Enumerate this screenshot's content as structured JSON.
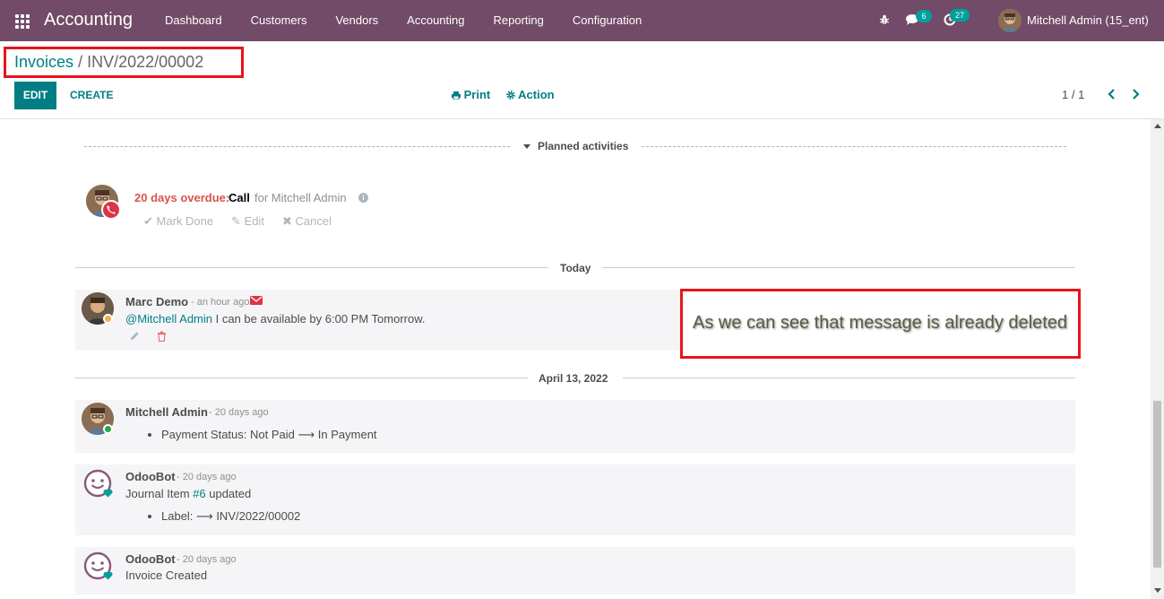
{
  "navbar": {
    "app_name": "Accounting",
    "menu": [
      "Dashboard",
      "Customers",
      "Vendors",
      "Accounting",
      "Reporting",
      "Configuration"
    ],
    "messages_count": "6",
    "activities_count": "27",
    "user": "Mitchell Admin (15_ent)",
    "bg_color": "#714b67"
  },
  "breadcrumb": {
    "parent": "Invoices",
    "separator": "/",
    "current": "INV/2022/00002"
  },
  "buttons": {
    "edit": "EDIT",
    "create": "CREATE",
    "print": "Print",
    "action": "Action"
  },
  "pager": {
    "value": "1 / 1"
  },
  "planned": {
    "title": "Planned activities",
    "activity": {
      "overdue": "20 days overdue:",
      "type": "Call",
      "assignee": "for Mitchell Admin",
      "mark_done": "Mark Done",
      "edit": "Edit",
      "cancel": "Cancel"
    }
  },
  "separators": {
    "today": "Today",
    "older": "April 13, 2022"
  },
  "messages": [
    {
      "author": "Marc Demo",
      "date": "- an hour ago",
      "mention": "@Mitchell Admin",
      "body": " I can be available by 6:00 PM Tomorrow."
    },
    {
      "author": "Mitchell Admin",
      "date": "- 20 days ago",
      "tracking_field": "Payment Status:",
      "old_value": "Not Paid",
      "new_value": "In Payment"
    },
    {
      "author": "OdooBot",
      "date": "- 20 days ago",
      "body_prefix": "Journal Item ",
      "body_link": "#6",
      "body_suffix": " updated",
      "tracking_field": "Label:",
      "new_value": "INV/2022/00002"
    },
    {
      "author": "OdooBot",
      "date": "- 20 days ago",
      "body": "Invoice Created"
    }
  ],
  "annotation": {
    "text": "As we can see that message is already deleted"
  },
  "colors": {
    "primary": "#017e84",
    "overdue": "#d9534f",
    "annotation_border": "#e8141a"
  }
}
